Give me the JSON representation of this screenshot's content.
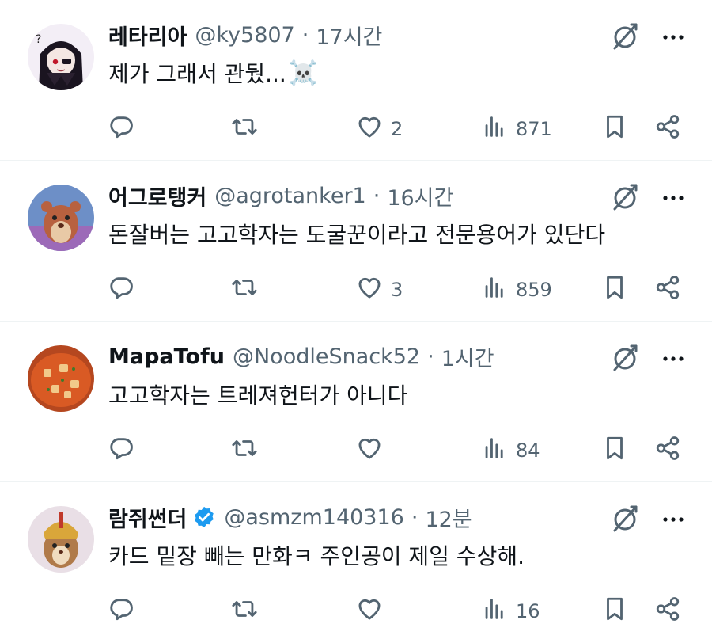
{
  "tweets": [
    {
      "name": "레타리아",
      "handle": "@ky5807",
      "separator": "·",
      "time": "17시간",
      "text": "제가 그래서 관뒀...",
      "emoji": "☠️",
      "verified": false,
      "replies": "",
      "retweets": "",
      "likes": "2",
      "views": "871",
      "avatar_bg": "#f3eef6"
    },
    {
      "name": "어그로탱커",
      "handle": "@agrotanker1",
      "separator": "·",
      "time": "16시간",
      "text": "돈잘버는 고고학자는 도굴꾼이라고 전문용어가 있단다",
      "emoji": "",
      "verified": false,
      "replies": "",
      "retweets": "",
      "likes": "3",
      "views": "859",
      "avatar_bg": "#6d8fc7"
    },
    {
      "name": "MapaTofu",
      "handle": "@NoodleSnack52",
      "separator": "·",
      "time": "1시간",
      "text": "고고학자는 트레져헌터가 아니다",
      "emoji": "",
      "verified": false,
      "replies": "",
      "retweets": "",
      "likes": "",
      "views": "84",
      "avatar_bg": "#b5471f"
    },
    {
      "name": "람쥐썬더",
      "handle": "@asmzm140316",
      "separator": "·",
      "time": "12분",
      "text": "카드 밑장 빼는 만화ㅋ 주인공이 제일 수상해.",
      "emoji": "",
      "verified": true,
      "replies": "",
      "retweets": "",
      "likes": "",
      "views": "16",
      "avatar_bg": "#e9dfe6"
    }
  ],
  "icons": {
    "reply": "reply-icon",
    "retweet": "retweet-icon",
    "like": "heart-icon",
    "views": "analytics-icon",
    "bookmark": "bookmark-icon",
    "share": "share-icon",
    "grok": "grok-icon",
    "more": "more-icon",
    "verified": "verified-badge-icon"
  },
  "colors": {
    "text": "#0f1419",
    "secondary": "#536471",
    "verified": "#1d9bf0",
    "divider": "#eff3f4"
  }
}
